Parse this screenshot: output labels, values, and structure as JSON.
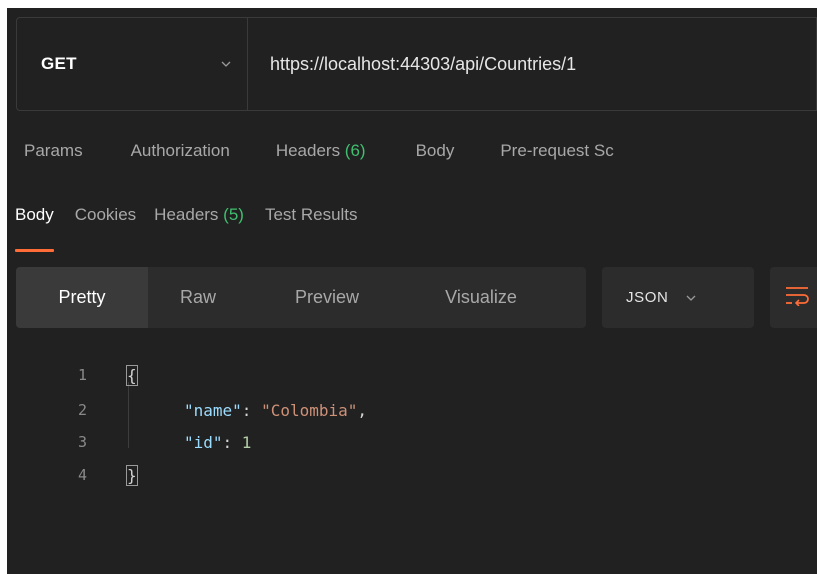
{
  "request": {
    "method": "GET",
    "url": "https://localhost:44303/api/Countries/1"
  },
  "request_tabs": [
    {
      "label": "Params",
      "count": ""
    },
    {
      "label": "Authorization",
      "count": ""
    },
    {
      "label": "Headers ",
      "count": "(6)"
    },
    {
      "label": "Body",
      "count": ""
    },
    {
      "label": "Pre-request Sc",
      "count": ""
    }
  ],
  "response_tabs": [
    {
      "label": "Body",
      "count": ""
    },
    {
      "label": "Cookies",
      "count": ""
    },
    {
      "label": "Headers ",
      "count": "(5)"
    },
    {
      "label": "Test Results",
      "count": ""
    }
  ],
  "view_modes": [
    "Pretty",
    "Raw",
    "Preview",
    "Visualize"
  ],
  "format": "JSON",
  "code": {
    "line_numbers": [
      "1",
      "2",
      "3",
      "4"
    ],
    "open_brace": "{",
    "close_brace": "}",
    "key1": "\"name\"",
    "val1": "\"Colombia\"",
    "key2": "\"id\"",
    "val2": "1",
    "sep": ": ",
    "comma": ","
  },
  "colors": {
    "background": "#212121",
    "accent": "#ff6c37",
    "count_green": "#3fbf6f"
  },
  "icons": {
    "method_dropdown": "chevron-down-icon",
    "format_dropdown": "chevron-down-icon",
    "wrap": "wrap-lines-icon"
  }
}
